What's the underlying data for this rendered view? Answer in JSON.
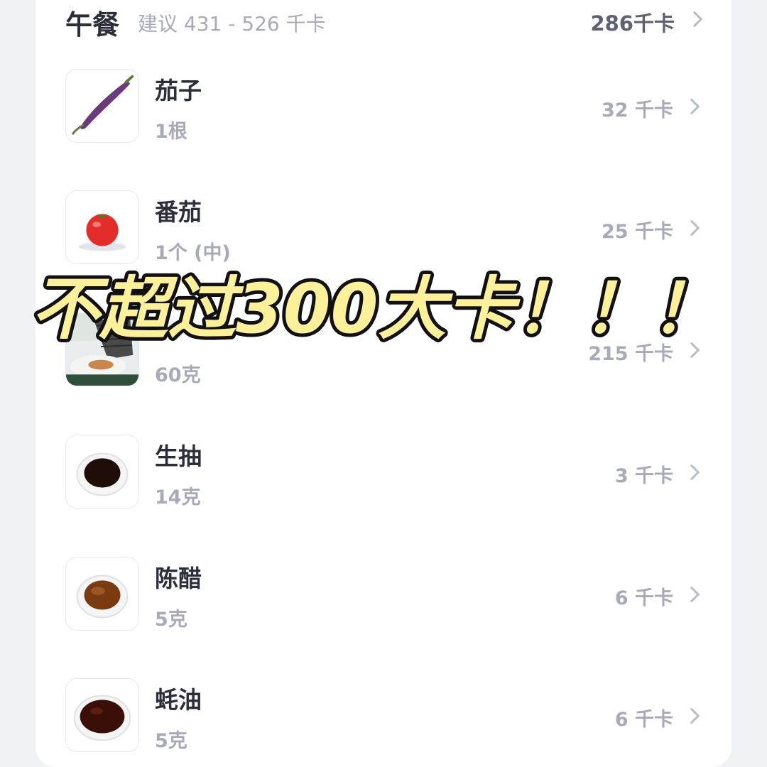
{
  "meal": {
    "title": "午餐",
    "suggestion": "建议 431 - 526 千卡",
    "total": "286千卡"
  },
  "items": [
    {
      "name": "茄子",
      "amount": "1根",
      "kcal": "32 千卡",
      "icon": "eggplant-icon"
    },
    {
      "name": "番茄",
      "amount": "1个 (中)",
      "kcal": "25 千卡",
      "icon": "tomato-icon"
    },
    {
      "name": "",
      "amount": "60克",
      "kcal": "215 千卡",
      "icon": "buckwheat-noodle-package-icon"
    },
    {
      "name": "生抽",
      "amount": "14克",
      "kcal": "3 千卡",
      "icon": "soy-sauce-dish-icon"
    },
    {
      "name": "陈醋",
      "amount": "5克",
      "kcal": "6 千卡",
      "icon": "vinegar-dish-icon"
    },
    {
      "name": "蚝油",
      "amount": "5克",
      "kcal": "6 千卡",
      "icon": "oyster-sauce-dish-icon"
    }
  ],
  "overlay": {
    "text": "不超过300大卡！！！",
    "fill_color": "#fdf09a",
    "stroke_color": "#111111"
  },
  "colors": {
    "background": "#f1f2f6",
    "card": "#ffffff",
    "primary_text": "#2b2f3a",
    "secondary_text": "#a7abb7"
  }
}
